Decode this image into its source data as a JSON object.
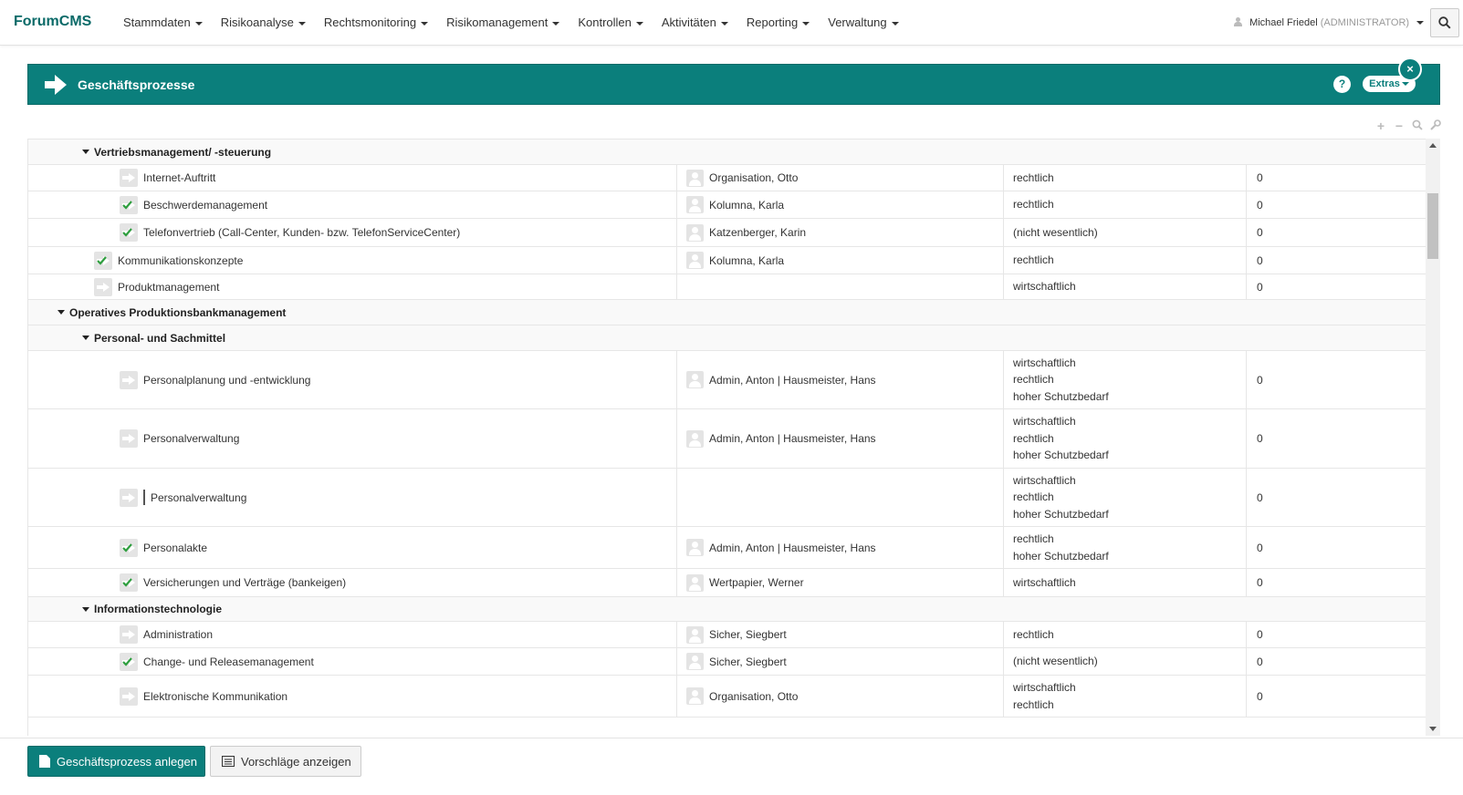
{
  "brand": {
    "forum": "Forum",
    "cms": "CMS"
  },
  "nav": [
    "Stammdaten",
    "Risikoanalyse",
    "Rechtsmonitoring",
    "Risikomanagement",
    "Kontrollen",
    "Aktivitäten",
    "Reporting",
    "Verwaltung"
  ],
  "user": {
    "name": "Michael Friedel",
    "role": "(ADMINISTRATOR)"
  },
  "panel": {
    "title": "Geschäftsprozesse",
    "help": "?",
    "extras": "Extras",
    "close": "×"
  },
  "colors": {
    "accent": "#0b7f7c",
    "check": "#2e9e3e"
  },
  "rows": [
    {
      "type": "group",
      "level": 2,
      "name": "Vertriebsmanagement/ -steuerung",
      "h": 28
    },
    {
      "type": "item",
      "level": 3,
      "name": "Internet-Auftritt",
      "check": false,
      "owner": "Organisation, Otto",
      "class": [
        "rechtlich"
      ],
      "count": "0",
      "h": 29
    },
    {
      "type": "item",
      "level": 3,
      "name": "Beschwerdemanagement",
      "check": true,
      "owner": "Kolumna, Karla",
      "class": [
        "rechtlich"
      ],
      "count": "0",
      "h": 30
    },
    {
      "type": "item",
      "level": 3,
      "name": "Telefonvertrieb (Call-Center, Kunden- bzw. TelefonServiceCenter)",
      "check": true,
      "owner": "Katzenberger, Karin",
      "class": [
        "(nicht wesentlich)"
      ],
      "count": "0",
      "h": 31
    },
    {
      "type": "item",
      "level": 2,
      "name": "Kommunikationskonzepte",
      "check": true,
      "owner": "Kolumna, Karla",
      "class": [
        "rechtlich"
      ],
      "count": "0",
      "h": 30
    },
    {
      "type": "item",
      "level": 2,
      "name": "Produktmanagement",
      "check": false,
      "owner": "",
      "class": [
        "wirtschaftlich"
      ],
      "count": "0",
      "h": 28
    },
    {
      "type": "group",
      "level": 1,
      "name": "Operatives Produktionsbankmanagement",
      "h": 28
    },
    {
      "type": "group",
      "level": 2,
      "name": "Personal- und Sachmittel",
      "h": 28
    },
    {
      "type": "item",
      "level": 3,
      "name": "Personalplanung und -entwicklung",
      "check": false,
      "owner": "Admin, Anton | Hausmeister, Hans",
      "class": [
        "wirtschaftlich",
        "rechtlich",
        "hoher Schutzbedarf"
      ],
      "count": "0",
      "h": 64
    },
    {
      "type": "item",
      "level": 3,
      "name": "Personalverwaltung",
      "check": false,
      "owner": "Admin, Anton | Hausmeister, Hans",
      "class": [
        "wirtschaftlich",
        "rechtlich",
        "hoher Schutzbedarf"
      ],
      "count": "0",
      "h": 65
    },
    {
      "type": "item",
      "level": 3,
      "name": "Personalverwaltung",
      "check": false,
      "cursor": true,
      "owner": "",
      "class": [
        "wirtschaftlich",
        "rechtlich",
        "hoher Schutzbedarf"
      ],
      "count": "0",
      "h": 64
    },
    {
      "type": "item",
      "level": 3,
      "name": "Personalakte",
      "check": true,
      "owner": "Admin, Anton | Hausmeister, Hans",
      "class": [
        "rechtlich",
        "hoher Schutzbedarf"
      ],
      "count": "0",
      "h": 46
    },
    {
      "type": "item",
      "level": 3,
      "name": "Versicherungen und Verträge (bankeigen)",
      "check": true,
      "owner": "Wertpapier, Werner",
      "class": [
        "wirtschaftlich"
      ],
      "count": "0",
      "h": 31
    },
    {
      "type": "group",
      "level": 2,
      "name": "Informationstechnologie",
      "h": 27
    },
    {
      "type": "item",
      "level": 3,
      "name": "Administration",
      "check": false,
      "owner": "Sicher, Siegbert",
      "class": [
        "rechtlich"
      ],
      "count": "0",
      "h": 29
    },
    {
      "type": "item",
      "level": 3,
      "name": "Change- und Releasemanagement",
      "check": true,
      "owner": "Sicher, Siegbert",
      "class": [
        "(nicht wesentlich)"
      ],
      "count": "0",
      "h": 30
    },
    {
      "type": "item",
      "level": 3,
      "name": "Elektronische Kommunikation",
      "check": false,
      "owner": "Organisation, Otto",
      "class": [
        "wirtschaftlich",
        "rechtlich"
      ],
      "count": "0",
      "h": 46
    }
  ],
  "footer": {
    "create": "Geschäftsprozess anlegen",
    "suggest": "Vorschläge anzeigen"
  },
  "icons": [
    "user-icon",
    "caret-down-icon",
    "search-icon",
    "arrow-right-icon",
    "help-icon",
    "close-icon",
    "plus-icon",
    "minus-icon",
    "wrench-icon",
    "checkmark-icon",
    "person-icon",
    "document-icon",
    "list-icon"
  ]
}
